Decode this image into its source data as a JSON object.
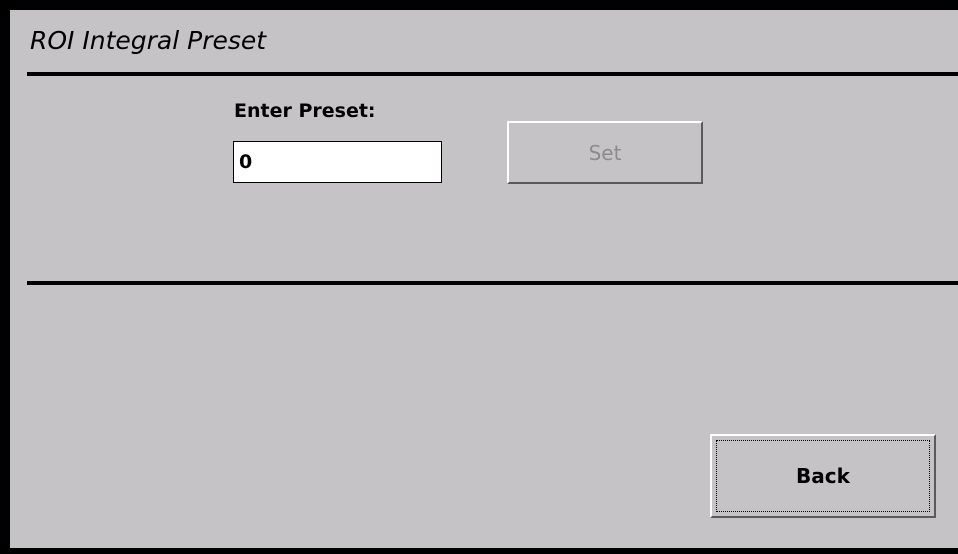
{
  "screen": {
    "title": "ROI Integral Preset"
  },
  "preset": {
    "label": "Enter Preset:",
    "value": "0",
    "set_button_label": "Set",
    "set_button_enabled": false
  },
  "footer": {
    "back_button_label": "Back"
  },
  "colors": {
    "background": "#c6c3c6",
    "frame": "#000000",
    "disabled_text": "#8c8a8c"
  }
}
